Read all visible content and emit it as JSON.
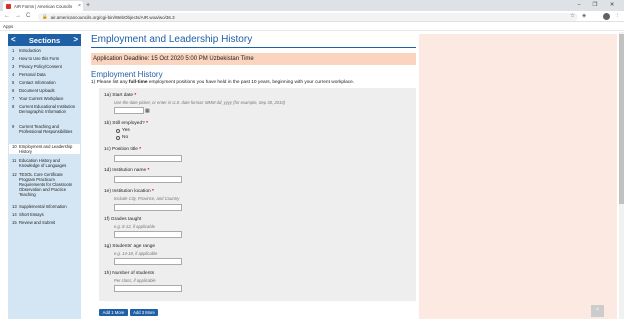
{
  "browser": {
    "tab_title": "AIR Forms | American Councils",
    "tab_close": "×",
    "new_tab": "+",
    "win_min": "–",
    "win_max": "❐",
    "win_close": "✕",
    "url": "air.americancouncils.org/cgi-bin/WebObjects/AIR.woa/wo/36.3",
    "bookmarks_apps": "Apps",
    "back": "←",
    "forward": "→",
    "reload": "C",
    "lock": "🔒",
    "star": "☆",
    "menu": "⋮"
  },
  "sidebar": {
    "title": "Sections",
    "prev": "<",
    "next": ">",
    "items": [
      {
        "num": "1",
        "label": "Introduction"
      },
      {
        "num": "2",
        "label": "How to Use this Form"
      },
      {
        "num": "3",
        "label": "Privacy Policy/Consent"
      },
      {
        "num": "4",
        "label": "Personal Data"
      },
      {
        "num": "5",
        "label": "Contact Information"
      },
      {
        "num": "6",
        "label": "Document Uploads"
      },
      {
        "num": "7",
        "label": "Your Current Workplace"
      },
      {
        "num": "8",
        "label": "Current Educational Institution Demographic Information"
      },
      {
        "num": "9",
        "label": "Current Teaching and Professional Responsibilities"
      },
      {
        "num": "10",
        "label": "Employment and Leadership History"
      },
      {
        "num": "11",
        "label": "Education History and Knowledge of Languages"
      },
      {
        "num": "12",
        "label": "TESOL Core Certificate Program Practicum Requirements for Classroom Observation and Practice Teaching"
      },
      {
        "num": "13",
        "label": "Supplemental Information"
      },
      {
        "num": "14",
        "label": "Short Essays"
      },
      {
        "num": "15",
        "label": "Review and Submit"
      }
    ]
  },
  "main": {
    "title": "Employment and Leadership History",
    "deadline": "Application Deadline: 15 Oct 2020 5:00 PM Uzbekistan Time",
    "subtitle": "Employment History",
    "instruction_pre": "1)   Please list any ",
    "instruction_bold": "full-time",
    "instruction_post": " employment positions you have held in the past 10 years, beginning with your current workplace.",
    "questions": {
      "q1a": {
        "label": "1a) Start date",
        "hint": "Use the date picker, or enter in U.S. date format: MMM dd, yyyy (for example, Sep 30, 2010)"
      },
      "q1b": {
        "label": "1b) Still employed?",
        "yes": "Yes",
        "no": "No"
      },
      "q1c": {
        "label": "1c) Position title"
      },
      "q1d": {
        "label": "1d) Institution name"
      },
      "q1e": {
        "label": "1e) Institution location",
        "hint": "Include City, Province, and Country"
      },
      "q1f": {
        "label": "1f) Grades taught",
        "hint": "e.g. 8-12, if applicable"
      },
      "q1g": {
        "label": "1g) Students' age range",
        "hint": "e.g. 14-18, if applicable"
      },
      "q1h": {
        "label": "1h) Number of students",
        "hint": "Per class, if applicable"
      }
    },
    "required_mark": "*",
    "add_1": "Add 1 More",
    "add_3": "Add 3 More",
    "back_to_top": "^"
  }
}
